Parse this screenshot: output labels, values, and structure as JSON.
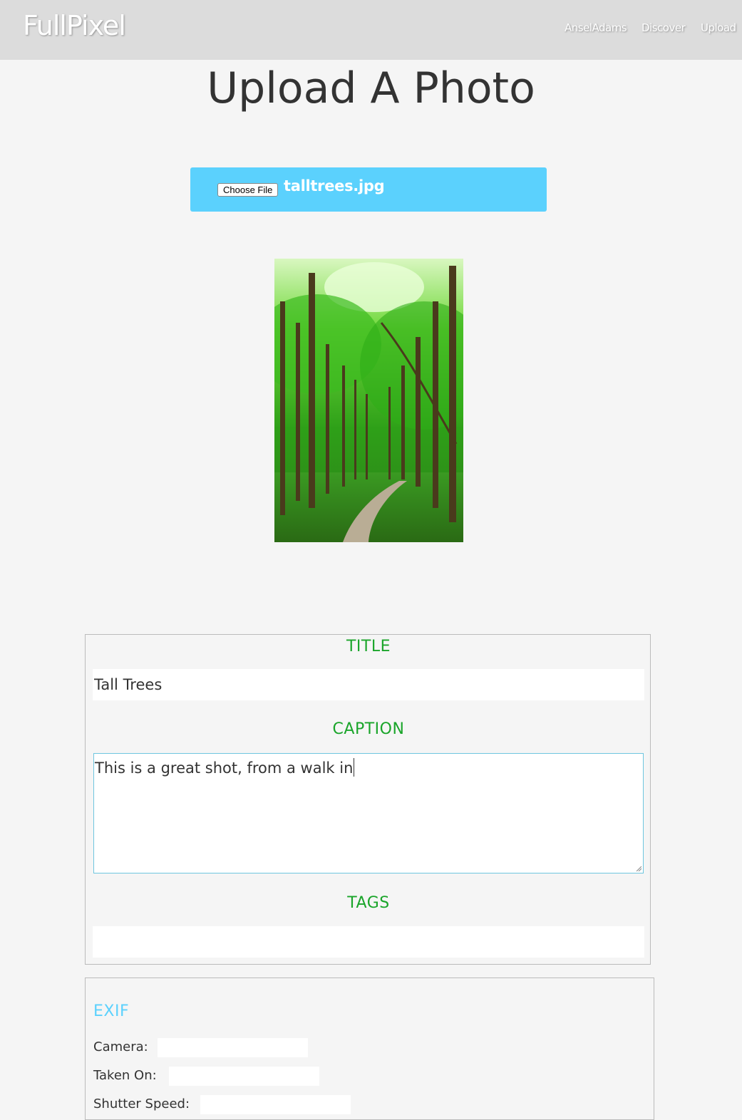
{
  "nav": {
    "brand": "FullPixel",
    "links": [
      "AnselAdams",
      "Discover",
      "Upload"
    ]
  },
  "page": {
    "title": "Upload A Photo"
  },
  "upload": {
    "button_label": "Choose File",
    "file_name": "talltrees.jpg"
  },
  "form": {
    "title_label": "TITLE",
    "title_value": "Tall Trees",
    "caption_label": "CAPTION",
    "caption_value": "This is a great shot, from a walk in",
    "tags_label": "TAGS",
    "tags_value": ""
  },
  "exif": {
    "heading": "EXIF",
    "fields": [
      {
        "label": "Camera:",
        "value": ""
      },
      {
        "label": "Taken On:",
        "value": ""
      },
      {
        "label": "Shutter Speed:",
        "value": ""
      }
    ]
  },
  "colors": {
    "accent_blue": "#5bd1fd",
    "label_green": "#1aa52a",
    "navbar": "#dcdcdc"
  }
}
